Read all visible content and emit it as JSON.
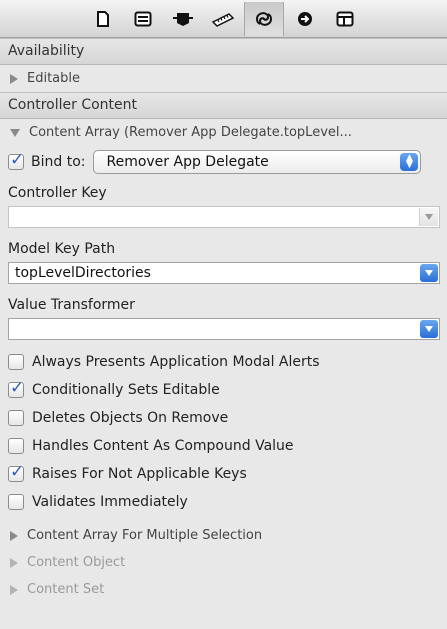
{
  "toolbar": {
    "icons": [
      "file-icon",
      "identity-icon",
      "attributes-icon",
      "size-ruler-icon",
      "bindings-icon",
      "connections-icon",
      "effects-icon"
    ],
    "active_index": 4
  },
  "sections": {
    "availability": {
      "title": "Availability",
      "editable": "Editable"
    },
    "controller_content": {
      "title": "Controller Content",
      "content_array": "Content Array (Remover App Delegate.topLevel...",
      "bind_to_label": "Bind to:",
      "bind_to_value": "Remover App Delegate",
      "bind_checked": true,
      "controller_key_label": "Controller Key",
      "controller_key_value": "",
      "model_key_path_label": "Model Key Path",
      "model_key_path_value": "topLevelDirectories",
      "value_transformer_label": "Value Transformer",
      "value_transformer_value": "",
      "options": [
        {
          "label": "Always Presents Application Modal Alerts",
          "checked": false
        },
        {
          "label": "Conditionally Sets Editable",
          "checked": true
        },
        {
          "label": "Deletes Objects On Remove",
          "checked": false
        },
        {
          "label": "Handles Content As Compound Value",
          "checked": false
        },
        {
          "label": "Raises For Not Applicable Keys",
          "checked": true
        },
        {
          "label": "Validates Immediately",
          "checked": false
        }
      ],
      "more": [
        {
          "label": "Content Array For Multiple Selection",
          "enabled": true
        },
        {
          "label": "Content Object",
          "enabled": false
        },
        {
          "label": "Content Set",
          "enabled": false
        }
      ]
    }
  },
  "colors": {
    "accent_blue": "#2a6fd6",
    "checkmark": "#2b5fbe"
  }
}
